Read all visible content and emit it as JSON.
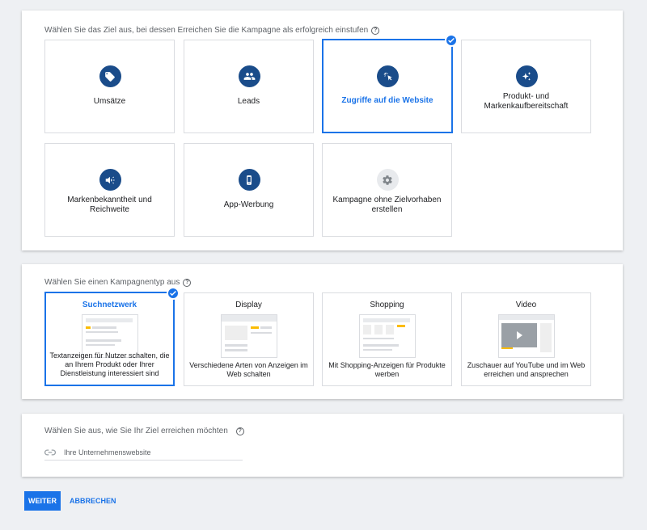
{
  "goal_section": {
    "title": "Wählen Sie das Ziel aus, bei dessen Erreichen Sie die Kampagne als erfolgreich einstufen",
    "options": [
      {
        "label": "Umsätze",
        "icon": "tag-icon",
        "selected": false
      },
      {
        "label": "Leads",
        "icon": "people-icon",
        "selected": false
      },
      {
        "label": "Zugriffe auf die Website",
        "icon": "cursor-click-icon",
        "selected": true
      },
      {
        "label": "Produkt- und Markenkaufbereitschaft",
        "icon": "sparkle-icon",
        "selected": false
      },
      {
        "label": "Markenbekanntheit und Reichweite",
        "icon": "megaphone-icon",
        "selected": false
      },
      {
        "label": "App-Werbung",
        "icon": "phone-icon",
        "selected": false
      },
      {
        "label": "Kampagne ohne Zielvorhaben erstellen",
        "icon": "gear-icon",
        "selected": false
      }
    ]
  },
  "type_section": {
    "title": "Wählen Sie einen Kampagnentyp aus",
    "options": [
      {
        "title": "Suchnetzwerk",
        "desc": "Textanzeigen für Nutzer schalten, die an Ihrem Produkt oder Ihrer Dienstleistung interessiert sind",
        "selected": true
      },
      {
        "title": "Display",
        "desc": "Verschiedene Arten von Anzeigen im Web schalten",
        "selected": false
      },
      {
        "title": "Shopping",
        "desc": "Mit Shopping-Anzeigen für Produkte werben",
        "selected": false
      },
      {
        "title": "Video",
        "desc": "Zuschauer auf YouTube und im Web erreichen und ansprechen",
        "selected": false
      }
    ]
  },
  "reach_section": {
    "title": "Wählen Sie aus, wie Sie Ihr Ziel erreichen möchten",
    "input_placeholder": "Ihre Unternehmenswebsite"
  },
  "actions": {
    "continue": "WEITER",
    "cancel": "ABBRECHEN"
  },
  "colors": {
    "accent": "#1a73e8",
    "icon_bg": "#1a4c8a",
    "ad_highlight": "#fbbc04"
  }
}
